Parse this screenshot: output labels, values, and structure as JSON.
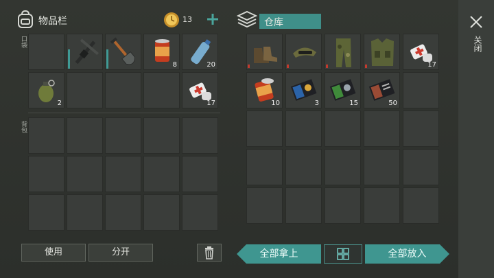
{
  "inventory": {
    "title": "物品栏",
    "coins": "13",
    "plus_icon": "plus-icon",
    "pocket_label": "口袋",
    "backpack_label": "背包",
    "pocket_items": [
      {
        "icon": "empty",
        "count": ""
      },
      {
        "icon": "crossbow-icon",
        "count": ""
      },
      {
        "icon": "shovel-icon",
        "count": ""
      },
      {
        "icon": "canned-food-icon",
        "count": "8"
      },
      {
        "icon": "water-bottle-icon",
        "count": "20"
      },
      {
        "icon": "grenade-icon",
        "count": "2"
      },
      {
        "icon": "empty",
        "count": ""
      },
      {
        "icon": "empty",
        "count": ""
      },
      {
        "icon": "empty",
        "count": ""
      },
      {
        "icon": "medkit-icon",
        "count": "17"
      }
    ],
    "use_label": "使用",
    "split_label": "分开"
  },
  "storage": {
    "title": "仓库",
    "items": [
      {
        "icon": "boots-icon",
        "count": ""
      },
      {
        "icon": "cap-icon",
        "count": ""
      },
      {
        "icon": "camo-pants-icon",
        "count": ""
      },
      {
        "icon": "camo-vest-icon",
        "count": ""
      },
      {
        "icon": "medkit-icon",
        "count": "17"
      },
      {
        "icon": "canned-food-icon",
        "count": "10"
      },
      {
        "icon": "blue-book-icon",
        "count": "3"
      },
      {
        "icon": "green-book-icon",
        "count": "15"
      },
      {
        "icon": "red-book-icon",
        "count": "50"
      }
    ],
    "take_all_label": "全部拿上",
    "put_all_label": "全部放入"
  },
  "close_label": "关闭",
  "colors": {
    "accent": "#3f9690",
    "red_mark": "#c23a2e"
  }
}
